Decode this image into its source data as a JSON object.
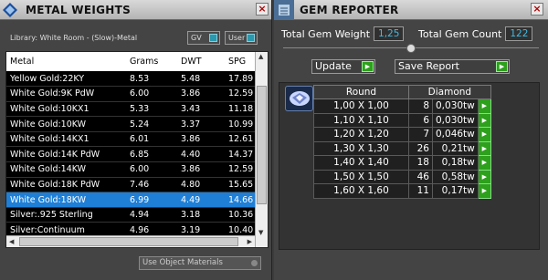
{
  "left_panel": {
    "title": "METAL WEIGHTS",
    "library_label": "Library: White Room - (Slow)-Metal",
    "toggles": {
      "gv": "GV",
      "user": "User"
    },
    "columns": [
      "Metal",
      "Grams",
      "DWT",
      "SPG"
    ],
    "rows": [
      [
        "Yellow Gold:22KY",
        "8.53",
        "5.48",
        "17.89"
      ],
      [
        "White Gold:9K PdW",
        "6.00",
        "3.86",
        "12.59"
      ],
      [
        "White Gold:10KX1",
        "5.33",
        "3.43",
        "11.18"
      ],
      [
        "White Gold:10KW",
        "5.24",
        "3.37",
        "10.99"
      ],
      [
        "White Gold:14KX1",
        "6.01",
        "3.86",
        "12.61"
      ],
      [
        "White Gold:14K PdW",
        "6.85",
        "4.40",
        "14.37"
      ],
      [
        "White Gold:14KW",
        "6.00",
        "3.86",
        "12.59"
      ],
      [
        "White Gold:18K PdW",
        "7.46",
        "4.80",
        "15.65"
      ],
      [
        "White Gold:18KW",
        "6.99",
        "4.49",
        "14.66"
      ],
      [
        "Silver:.925 Sterling",
        "4.94",
        "3.18",
        "10.36"
      ],
      [
        "Silver:Continuum",
        "4.96",
        "3.19",
        "10.40"
      ]
    ],
    "selected_row": 8,
    "use_object_materials": "Use Object Materials"
  },
  "right_panel": {
    "title": "GEM REPORTER",
    "total_weight_label": "Total Gem Weight",
    "total_weight_value": "1,25",
    "total_count_label": "Total Gem Count",
    "total_count_value": "122",
    "update_button": "Update",
    "save_button": "Save Report",
    "shape_header": "Round",
    "cut_header": "Diamond",
    "gems": [
      {
        "size": "1,00 X 1,00",
        "count": "8",
        "weight": "0,030tw"
      },
      {
        "size": "1,10 X 1,10",
        "count": "6",
        "weight": "0,030tw"
      },
      {
        "size": "1,20 X 1,20",
        "count": "7",
        "weight": "0,046tw"
      },
      {
        "size": "1,30 X 1,30",
        "count": "26",
        "weight": "0,21tw"
      },
      {
        "size": "1,40 X 1,40",
        "count": "18",
        "weight": "0,18tw"
      },
      {
        "size": "1,50 X 1,50",
        "count": "46",
        "weight": "0,58tw"
      },
      {
        "size": "1,60 X 1,60",
        "count": "11",
        "weight": "0,17tw"
      }
    ]
  },
  "icons": {
    "metal_logo": "metal-logo-icon",
    "gem_logo": "gem-reporter-icon",
    "close": "close-icon",
    "go": "arrow-right-icon",
    "diamond": "diamond-icon"
  },
  "colors": {
    "selection": "#1f7fd6",
    "value_text": "#46b9e0",
    "go_button": "#2da01c"
  }
}
